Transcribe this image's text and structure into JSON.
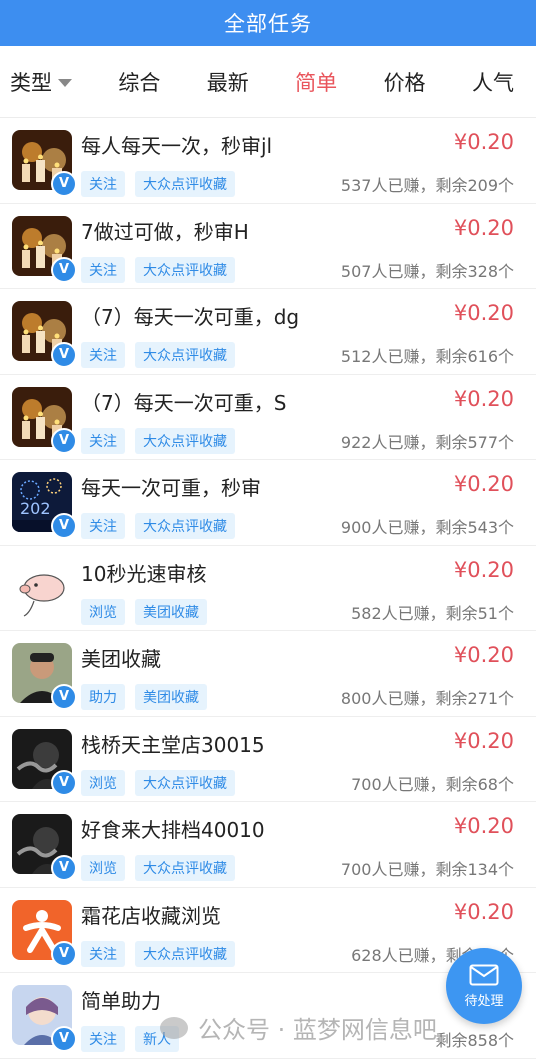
{
  "header": {
    "title": "全部任务"
  },
  "tabs": {
    "type_label": "类型",
    "items": [
      "综合",
      "最新",
      "简单",
      "价格",
      "人气"
    ],
    "active_index": 2
  },
  "tasks": [
    {
      "title": "每人每天一次，秒审jl",
      "price": "¥0.20",
      "tags": [
        "关注",
        "大众点评收藏"
      ],
      "earned": "537人已赚，",
      "remaining": "剩余209个",
      "badge": "V",
      "avatar": "candles"
    },
    {
      "title": "7做过可做，秒审H",
      "price": "¥0.20",
      "tags": [
        "关注",
        "大众点评收藏"
      ],
      "earned": "507人已赚，",
      "remaining": "剩余328个",
      "badge": "V",
      "avatar": "candles"
    },
    {
      "title": "（7）每天一次可重，dg",
      "price": "¥0.20",
      "tags": [
        "关注",
        "大众点评收藏"
      ],
      "earned": "512人已赚，",
      "remaining": "剩余616个",
      "badge": "V",
      "avatar": "candles"
    },
    {
      "title": "（7）每天一次可重，S",
      "price": "¥0.20",
      "tags": [
        "关注",
        "大众点评收藏"
      ],
      "earned": "922人已赚，",
      "remaining": "剩余577个",
      "badge": "V",
      "avatar": "candles"
    },
    {
      "title": "每天一次可重，秒审",
      "price": "¥0.20",
      "tags": [
        "关注",
        "大众点评收藏"
      ],
      "earned": "900人已赚，",
      "remaining": "剩余543个",
      "badge": "V",
      "avatar": "fireworks"
    },
    {
      "title": "10秒光速审核",
      "price": "¥0.20",
      "tags": [
        "浏览",
        "美团收藏"
      ],
      "earned": "582人已赚，",
      "remaining": "剩余51个",
      "badge": "",
      "avatar": "pig"
    },
    {
      "title": "美团收藏",
      "price": "¥0.20",
      "tags": [
        "助力",
        "美团收藏"
      ],
      "earned": "800人已赚，",
      "remaining": "剩余271个",
      "badge": "V",
      "avatar": "man"
    },
    {
      "title": "栈桥天主堂店30015",
      "price": "¥0.20",
      "tags": [
        "浏览",
        "大众点评收藏"
      ],
      "earned": "700人已赚，",
      "remaining": "剩余68个",
      "badge": "V",
      "avatar": "smoke"
    },
    {
      "title": "好食来大排档40010",
      "price": "¥0.20",
      "tags": [
        "浏览",
        "大众点评收藏"
      ],
      "earned": "700人已赚，",
      "remaining": "剩余134个",
      "badge": "V",
      "avatar": "smoke"
    },
    {
      "title": "霜花店收藏浏览",
      "price": "¥0.20",
      "tags": [
        "关注",
        "大众点评收藏"
      ],
      "earned": "628人已赚，",
      "remaining": "剩余98个",
      "badge": "V",
      "avatar": "orange"
    },
    {
      "title": "简单助力",
      "price": "¥0.20",
      "tags": [
        "关注",
        "新人"
      ],
      "earned": "",
      "remaining": "剩余858个",
      "badge": "V",
      "avatar": "anime"
    }
  ],
  "fab": {
    "label": "待处理",
    "icon": "envelope-icon"
  },
  "watermark": {
    "text": "公众号 · 蓝梦网信息吧"
  },
  "colors": {
    "header_bg": "#3d8ef0",
    "price": "#e0505a",
    "tag_bg": "#e6f3fd",
    "tag_text": "#2f8be6"
  }
}
